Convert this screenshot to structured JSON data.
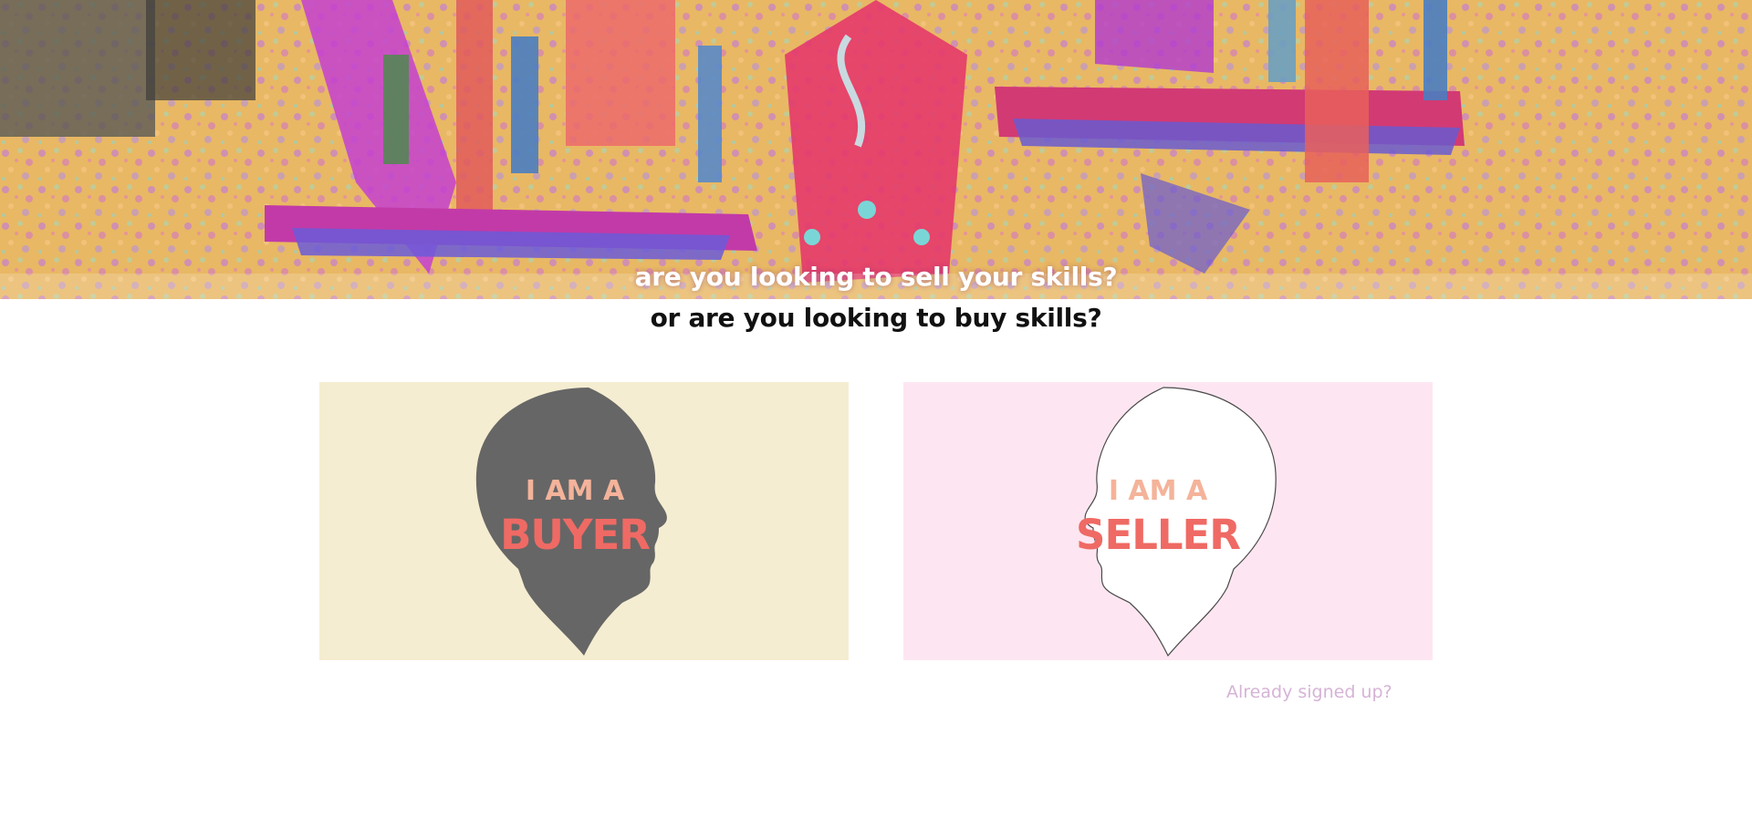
{
  "hero": {
    "image_description_icon": "marketplace-balance-scale-illustration",
    "question_sell": "are you looking to sell your skills?",
    "question_buy": "or are you looking to buy skills?"
  },
  "buyer_card": {
    "line1": "I AM A",
    "line2": "BUYER",
    "background": "#f5edd1",
    "head_color": "#666666"
  },
  "seller_card": {
    "line1": "I AM A",
    "line2": "SELLER",
    "background": "#fde6f1",
    "head_color": "#ffffff"
  },
  "login_link": {
    "label": "Already signed up?"
  },
  "colors": {
    "accent_red": "#ef6a64",
    "accent_peach": "#f4b39a",
    "link": "#d6b3d6"
  }
}
